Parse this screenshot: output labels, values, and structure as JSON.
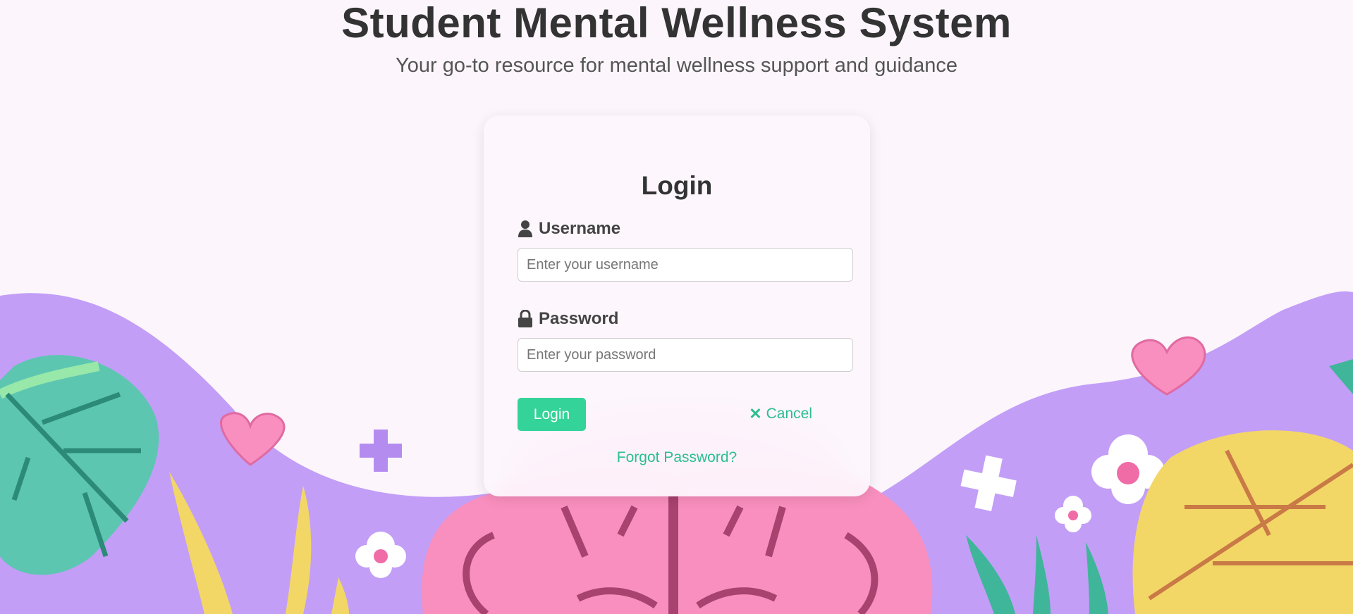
{
  "header": {
    "title": "Student Mental Wellness System",
    "subtitle": "Your go-to resource for mental wellness support and guidance"
  },
  "login_card": {
    "title": "Login",
    "username": {
      "label": "Username",
      "icon": "user-icon",
      "placeholder": "Enter your username",
      "value": ""
    },
    "password": {
      "label": "Password",
      "icon": "lock-icon",
      "placeholder": "Enter your password",
      "value": ""
    },
    "login_button": "Login",
    "cancel_button": "Cancel",
    "cancel_icon": "close-icon",
    "forgot_link": "Forgot Password?"
  },
  "colors": {
    "accent_green": "#34d399",
    "link_green": "#2bbf8e",
    "background": "#fcf6fc",
    "wave_purple": "#c29ef7",
    "brain_pink": "#f98fbe",
    "leaf_green": "#5cc6b1",
    "leaf_yellow": "#f2d767"
  }
}
